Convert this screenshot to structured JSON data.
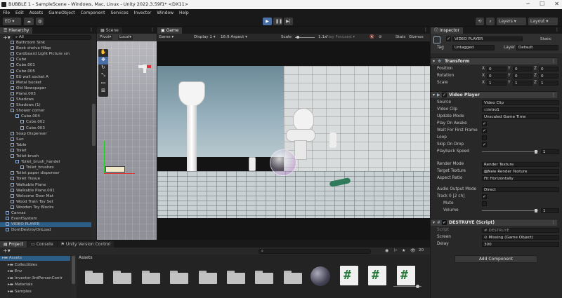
{
  "window": {
    "title": "BUBBLE 1 - SampleScene - Windows, Mac, Linux - Unity 2022.3.59f1* <DX11>",
    "controls": [
      "─",
      "☐",
      "✕"
    ]
  },
  "menu": [
    "File",
    "Edit",
    "Assets",
    "GameObject",
    "Component",
    "Services",
    "Invector",
    "Window",
    "Help"
  ],
  "toolbar": {
    "account": "ED ▾",
    "layers": "Layers",
    "layout": "Layout"
  },
  "hierarchy": {
    "tab": "Hierarchy",
    "search_value": "All",
    "items": [
      {
        "label": "Bathroom Sink",
        "indent": 1
      },
      {
        "label": "Book shelve fillep",
        "indent": 1
      },
      {
        "label": "Cardboard Light Picture sm",
        "indent": 1
      },
      {
        "label": "Cube",
        "indent": 1
      },
      {
        "label": "Cube.001",
        "indent": 1
      },
      {
        "label": "Cube.005",
        "indent": 1
      },
      {
        "label": "EU wall socket A",
        "indent": 1
      },
      {
        "label": "Metal bucket",
        "indent": 1
      },
      {
        "label": "Old Newspaper",
        "indent": 1
      },
      {
        "label": "Plane.003",
        "indent": 1
      },
      {
        "label": "Shadows",
        "indent": 1
      },
      {
        "label": "Shadows (1)",
        "indent": 1
      },
      {
        "label": "Shower corner",
        "indent": 1
      },
      {
        "label": "Cube.004",
        "indent": 2
      },
      {
        "label": "Cube.002",
        "indent": 3
      },
      {
        "label": "Cube.003",
        "indent": 3
      },
      {
        "label": "Soap Dispenser",
        "indent": 1
      },
      {
        "label": "Sun",
        "indent": 1
      },
      {
        "label": "Table",
        "indent": 1
      },
      {
        "label": "Toilet",
        "indent": 1
      },
      {
        "label": "Toilet brush",
        "indent": 1
      },
      {
        "label": "Toilet_brush_handel",
        "indent": 2
      },
      {
        "label": "Toilet_brushes",
        "indent": 3
      },
      {
        "label": "Toilet paper dispenser",
        "indent": 1
      },
      {
        "label": "Toilet Tissue",
        "indent": 1
      },
      {
        "label": "Walkable Plane",
        "indent": 1
      },
      {
        "label": "Walkable Plane.001",
        "indent": 1
      },
      {
        "label": "Welcome Door Mat",
        "indent": 1
      },
      {
        "label": "Wood Train Toy Set",
        "indent": 1
      },
      {
        "label": "Wooden Toy Blocks",
        "indent": 1
      },
      {
        "label": "Canvas",
        "indent": 0
      },
      {
        "label": "EventSystem",
        "indent": 0
      },
      {
        "label": "VIDEO PLAYER",
        "indent": 0,
        "selected": true
      },
      {
        "label": "DontDestroyOnLoad",
        "indent": -1
      }
    ]
  },
  "scene": {
    "tab": "Scene",
    "pivot": "Pivot",
    "local": "Local"
  },
  "game": {
    "tab": "Game",
    "display_mode": "Game",
    "display": "Display 1",
    "aspect": "16:9 Aspect",
    "scale_label": "Scale",
    "scale_value": "1.1x",
    "play_focused": "Play Focused",
    "stats": "Stats",
    "gizmos": "Gizmos"
  },
  "inspector": {
    "tab": "Inspector",
    "object_name": "VIDEO PLAYER",
    "static": "Static",
    "tag_label": "Tag",
    "tag_value": "Untagged",
    "layer_label": "Layer",
    "layer_value": "Default",
    "transform": {
      "header": "Transform",
      "rows": [
        {
          "label": "Position",
          "x": "0",
          "y": "0",
          "z": "0"
        },
        {
          "label": "Rotation",
          "x": "0",
          "y": "0",
          "z": "0"
        },
        {
          "label": "Scale",
          "x": "1",
          "y": "1",
          "z": "1"
        }
      ]
    },
    "video_player": {
      "header": "Video Player",
      "source_label": "Source",
      "source": "Video Clip",
      "clip_label": "Video Clip",
      "clip": "intro1",
      "update_label": "Update Mode",
      "update": "Unscaled Game Time",
      "play_on_awake": "Play On Awake",
      "wait_first": "Wait For First Frame",
      "loop": "Loop",
      "skip_on_drop": "Skip On Drop",
      "playback_label": "Playback Speed",
      "playback": "1",
      "render_mode_label": "Render Mode",
      "render_mode": "Render Texture",
      "target_label": "Target Texture",
      "target": "New Render Texture",
      "aspect_label": "Aspect Ratio",
      "aspect": "Fit Horizontally",
      "audio_label": "Audio Output Mode",
      "audio": "Direct",
      "track_label": "Track 0 [2 ch]",
      "mute": "Mute",
      "volume_label": "Volume",
      "volume": "1"
    },
    "destruye": {
      "header": "DESTRUYE (Script)",
      "script_label": "Script",
      "script": "DESTRUYE",
      "screen_label": "Screen",
      "screen": "Missing (Game Object)",
      "delay_label": "Delay",
      "delay": "300"
    },
    "add_component": "Add Component"
  },
  "project": {
    "tabs": [
      "Project",
      "Console",
      "Unity Version Control"
    ],
    "count": "20",
    "tree": [
      {
        "label": "Assets",
        "indent": 0,
        "selected": true
      },
      {
        "label": "Collectibles",
        "indent": 1
      },
      {
        "label": "Env",
        "indent": 1
      },
      {
        "label": "Invector-3rdPersonContr",
        "indent": 1
      },
      {
        "label": "Materials",
        "indent": 1
      },
      {
        "label": "Samples",
        "indent": 1
      }
    ],
    "breadcrumb": "Assets",
    "grid": [
      "folder",
      "folder",
      "folder",
      "folder",
      "folder",
      "folder",
      "folder",
      "folder",
      "sphere",
      "script",
      "script",
      "script"
    ]
  },
  "colors": {
    "accent": "#2c5d87",
    "play_active": "#4a6fa5"
  }
}
